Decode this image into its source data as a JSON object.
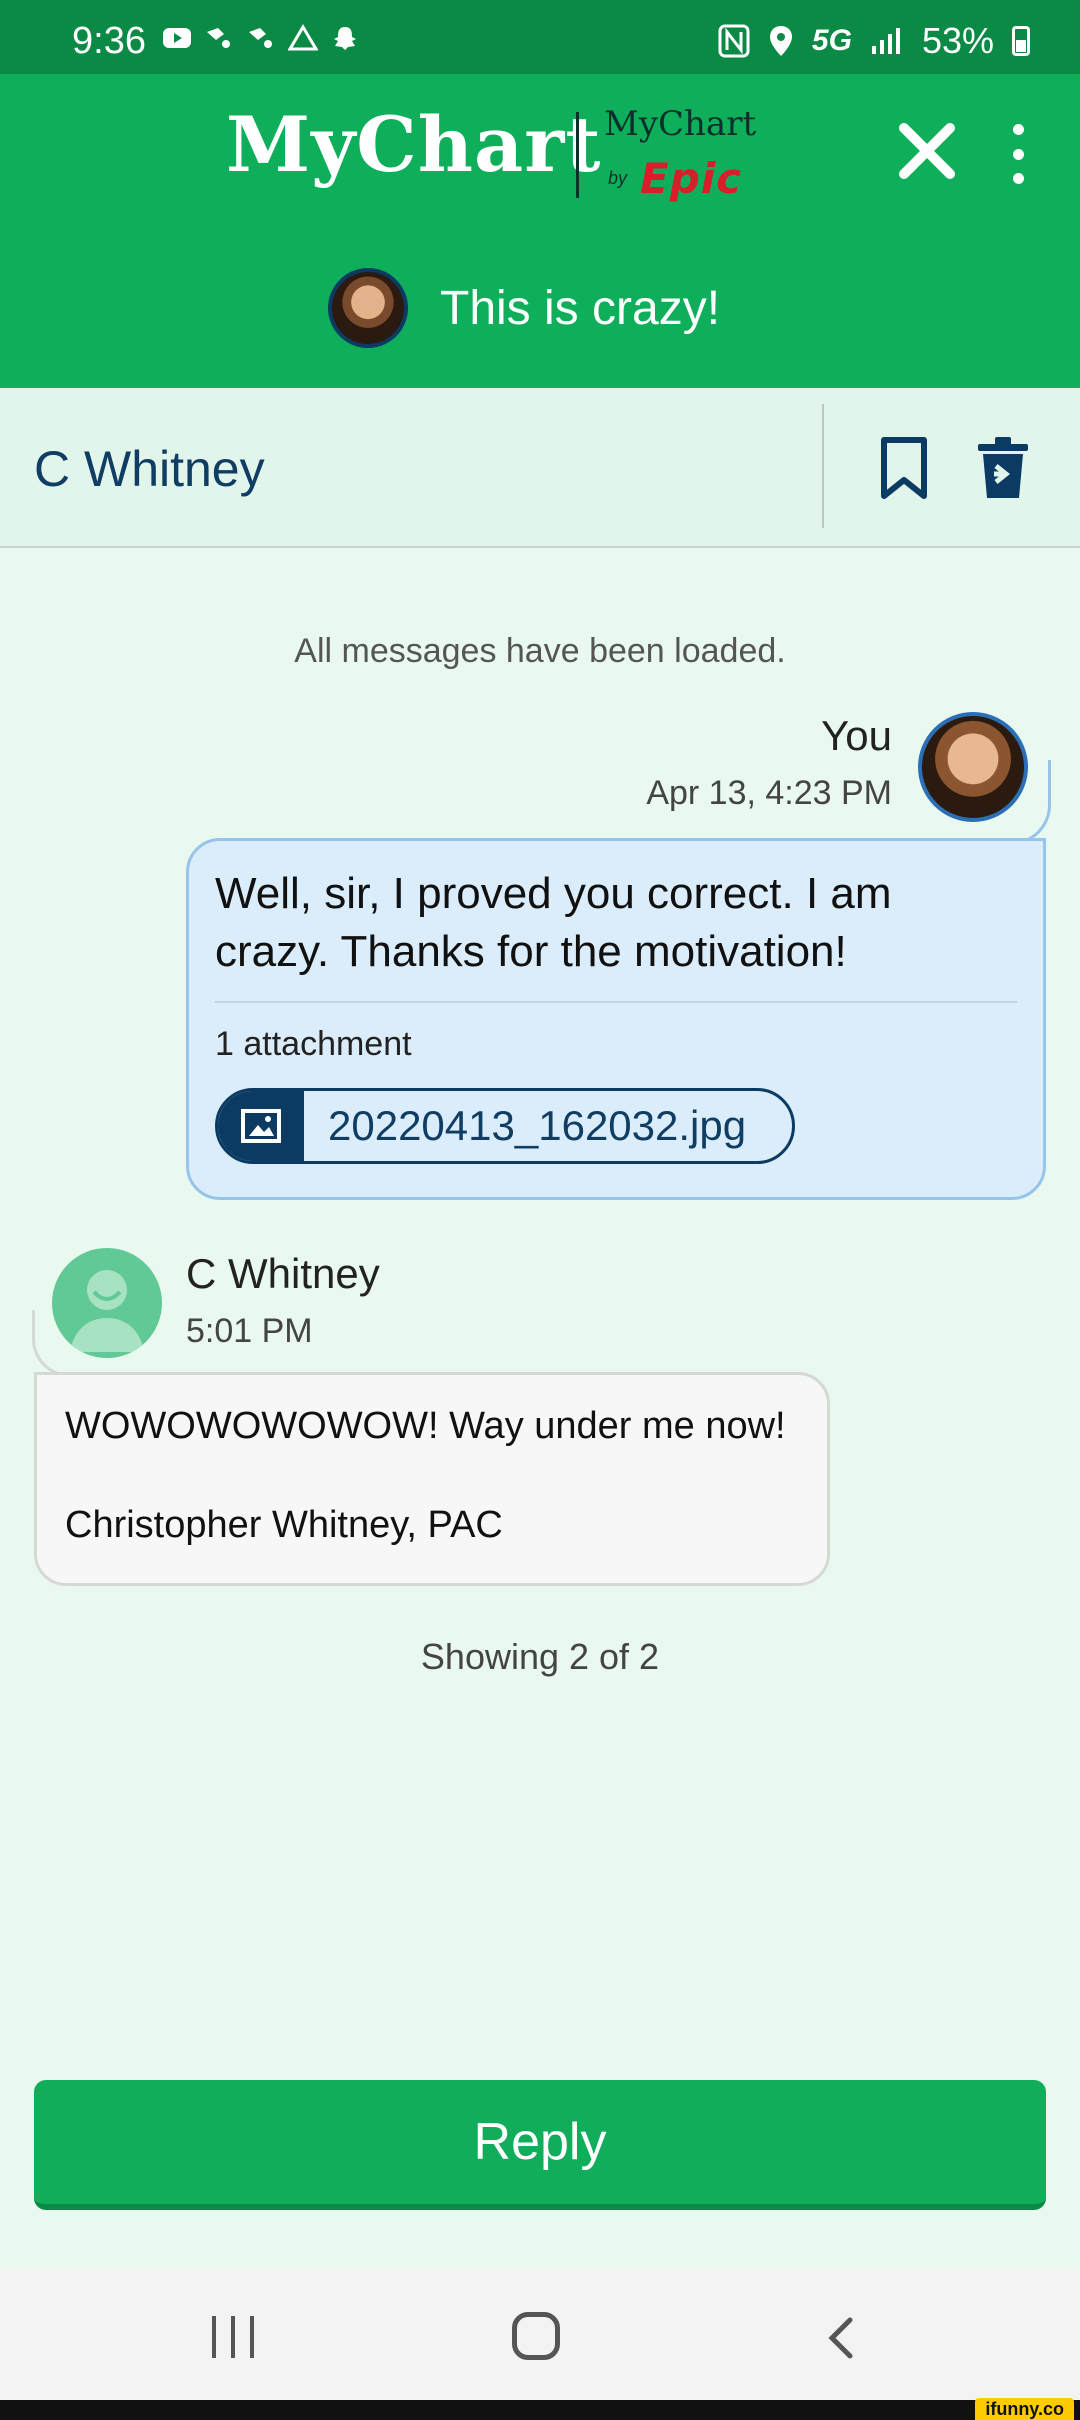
{
  "status_bar": {
    "time": "9:36",
    "network": "5G",
    "battery": "53%"
  },
  "header": {
    "logo_text": "MyChart",
    "brand_top": "MyChart",
    "brand_by": "by",
    "brand_epic": "Epic",
    "subject": "This is crazy!"
  },
  "conversation": {
    "name": "C Whitney"
  },
  "thread": {
    "loaded_note": "All messages have been loaded.",
    "messages": [
      {
        "sender": "You",
        "timestamp": "Apr 13, 4:23 PM",
        "body": "Well, sir, I proved you correct. I am crazy. Thanks for the motivation!",
        "attachment_label": "1 attachment",
        "attachment_file": "20220413_162032.jpg"
      },
      {
        "sender": "C Whitney",
        "timestamp": "5:01 PM",
        "body_line1": "WOWOWOWOWOW! Way under me now!",
        "body_line2": "Christopher Whitney, PAC"
      }
    ],
    "showing": "Showing 2 of 2"
  },
  "actions": {
    "reply_label": "Reply"
  },
  "watermark": "ifunny.co",
  "colors": {
    "header_green": "#0fae5a",
    "status_green": "#0a8a45",
    "navy": "#0b3a63",
    "bubble_blue": "#dbecfa",
    "page_bg": "#e9f9f0"
  }
}
